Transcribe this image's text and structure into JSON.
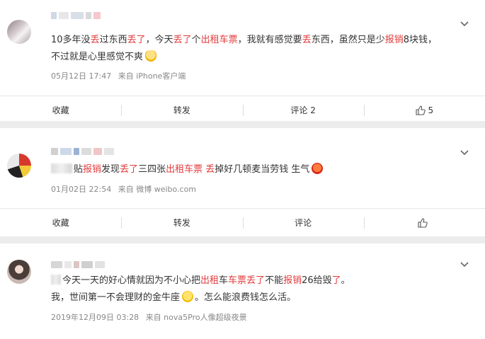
{
  "posts": [
    {
      "segments": [
        {
          "t": "10多年没"
        },
        {
          "t": "丢",
          "hl": true
        },
        {
          "t": "过东西"
        },
        {
          "t": "丢了",
          "hl": true
        },
        {
          "t": "，今天"
        },
        {
          "t": "丢了",
          "hl": true
        },
        {
          "t": "个"
        },
        {
          "t": "出租车票",
          "hl": true
        },
        {
          "t": "，我就有感觉要"
        },
        {
          "t": "丢",
          "hl": true
        },
        {
          "t": "东西，虽然只是少"
        },
        {
          "t": "报销",
          "hl": true
        },
        {
          "t": "8块钱，"
        }
      ],
      "line2": "不过就是心里感觉不爽",
      "date": "05月12日 17:47",
      "source": "来自 iPhone客户端",
      "actions": {
        "fav": "收藏",
        "repost": "转发",
        "comment": "评论 2",
        "like": "5"
      }
    },
    {
      "segments": [
        {
          "t": "贴"
        },
        {
          "t": "报销",
          "hl": true
        },
        {
          "t": "发现"
        },
        {
          "t": "丢了",
          "hl": true
        },
        {
          "t": "三四张"
        },
        {
          "t": "出租车票",
          "hl": true
        },
        {
          "t": " "
        },
        {
          "t": "丢",
          "hl": true
        },
        {
          "t": "掉好几顿麦当劳钱 生气"
        }
      ],
      "date": "01月02日 22:54",
      "source": "来自 微博 weibo.com",
      "actions": {
        "fav": "收藏",
        "repost": "转发",
        "comment": "评论",
        "like": ""
      }
    },
    {
      "segments": [
        {
          "t": "今天一天的好心情就因为不小心把"
        },
        {
          "t": "出租",
          "hl": true
        },
        {
          "t": "车"
        },
        {
          "t": "车票丢了",
          "hl": true
        },
        {
          "t": "不能"
        },
        {
          "t": "报销",
          "hl": true
        },
        {
          "t": "26给毁"
        },
        {
          "t": "了",
          "hl": true
        },
        {
          "t": "。"
        }
      ],
      "line2a": "我，世间第一不会理财的金牛座",
      "line2b": "。怎么能浪费钱怎么活。",
      "date": "2019年12月09日 03:28",
      "source": "来自 nova5Pro人像超级夜景"
    }
  ],
  "colors": {
    "highlight": "#e33a3a",
    "meta": "#888888"
  },
  "icons": [
    "chevron-down-icon",
    "thumbs-up-icon",
    "emoji"
  ]
}
